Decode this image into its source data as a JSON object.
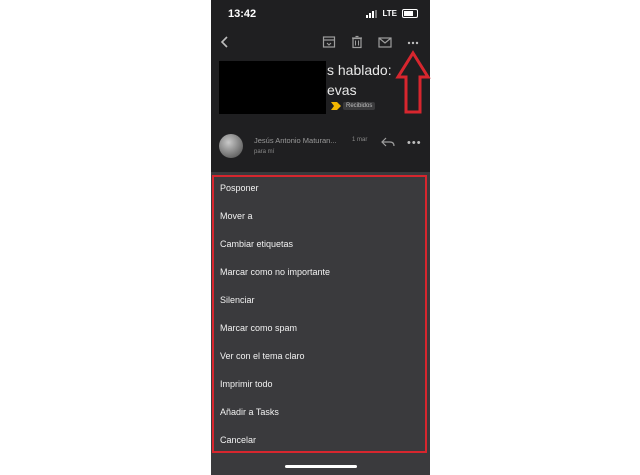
{
  "status_bar": {
    "time": "13:42",
    "network": "LTE"
  },
  "toolbar": {
    "back_icon": "back-arrow-icon",
    "archive_icon": "archive-icon",
    "delete_icon": "trash-icon",
    "mark_unread_icon": "mail-icon",
    "more_icon": "more-horizontal-icon"
  },
  "email": {
    "subject_line1": "s hablado:",
    "subject_line2": "evas",
    "label": "Recibidos",
    "sender": "Jesús Antonio Maturan...",
    "date": "1 mar",
    "recipient": "para mí"
  },
  "menu": {
    "items": [
      "Posponer",
      "Mover a",
      "Cambiar etiquetas",
      "Marcar como no importante",
      "Silenciar",
      "Marcar como spam",
      "Ver con el tema claro",
      "Imprimir todo",
      "Añadir a Tasks",
      "Cancelar"
    ]
  },
  "colors": {
    "background": "#1f1f21",
    "sheet": "#3a3a3d",
    "highlight": "#d7262e",
    "label_marker": "#f2b600"
  }
}
